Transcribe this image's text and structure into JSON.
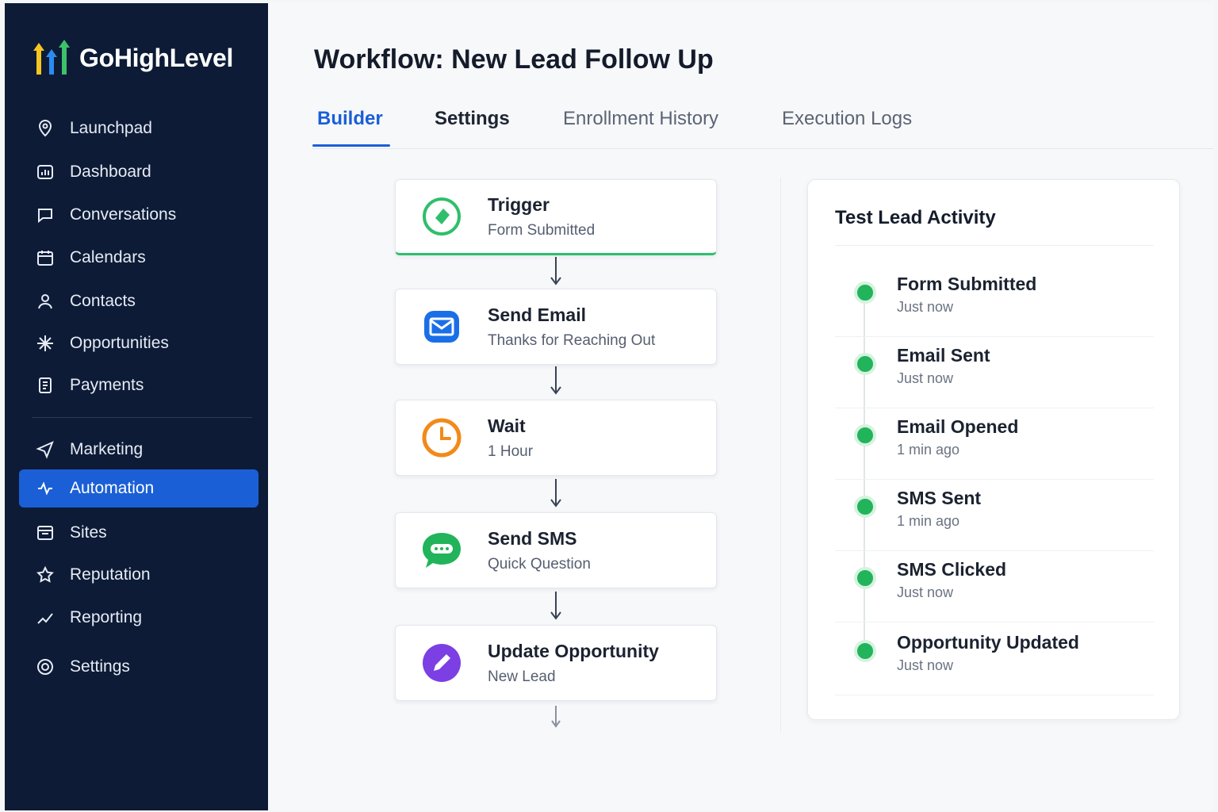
{
  "app": {
    "name": "GoHighLevel"
  },
  "sidebar": {
    "items": [
      {
        "label": "Launchpad",
        "icon": "location-pin-icon"
      },
      {
        "label": "Dashboard",
        "icon": "dashboard-icon"
      },
      {
        "label": "Conversations",
        "icon": "chat-bubble-icon"
      },
      {
        "label": "Calendars",
        "icon": "calendar-icon"
      },
      {
        "label": "Contacts",
        "icon": "contacts-icon"
      },
      {
        "label": "Opportunities",
        "icon": "sparkle-icon"
      },
      {
        "label": "Payments",
        "icon": "payments-icon"
      },
      {
        "label": "Marketing",
        "icon": "paper-plane-icon"
      },
      {
        "label": "Automation",
        "icon": "automation-icon",
        "active": true
      },
      {
        "label": "Sites",
        "icon": "sites-icon"
      },
      {
        "label": "Reputation",
        "icon": "star-icon"
      },
      {
        "label": "Reporting",
        "icon": "reporting-icon"
      },
      {
        "label": "Settings",
        "icon": "gear-icon"
      }
    ]
  },
  "page": {
    "title": "Workflow: New Lead Follow Up",
    "tabs": [
      {
        "label": "Builder",
        "active": true
      },
      {
        "label": "Settings"
      },
      {
        "label": "Enrollment History"
      },
      {
        "label": "Execution Logs"
      }
    ]
  },
  "workflow": {
    "steps": [
      {
        "title": "Trigger",
        "subtitle": "Form Submitted",
        "icon": "trigger-icon",
        "color": "#2fbf6a"
      },
      {
        "title": "Send Email",
        "subtitle": "Thanks for Reaching Out",
        "icon": "email-icon",
        "color": "#1a6fe8"
      },
      {
        "title": "Wait",
        "subtitle": "1 Hour",
        "icon": "clock-icon",
        "color": "#f28a1a"
      },
      {
        "title": "Send SMS",
        "subtitle": "Quick Question",
        "icon": "sms-icon",
        "color": "#22b45a"
      },
      {
        "title": "Update Opportunity",
        "subtitle": "New Lead",
        "icon": "pencil-icon",
        "color": "#7b3fe4"
      }
    ]
  },
  "activity": {
    "title": "Test Lead Activity",
    "items": [
      {
        "title": "Form Submitted",
        "time": "Just now"
      },
      {
        "title": "Email Sent",
        "time": "Just now"
      },
      {
        "title": "Email Opened",
        "time": "1 min ago"
      },
      {
        "title": "SMS Sent",
        "time": "1 min ago"
      },
      {
        "title": "SMS Clicked",
        "time": "Just now"
      },
      {
        "title": "Opportunity Updated",
        "time": "Just now"
      }
    ]
  },
  "colors": {
    "sidebar_bg": "#0d1b36",
    "accent": "#1a5fd6",
    "success": "#22b45a"
  }
}
